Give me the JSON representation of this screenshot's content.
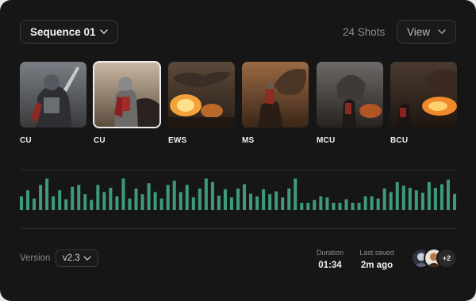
{
  "header": {
    "sequence_label": "Sequence 01",
    "shots_count": "24 Shots",
    "view_label": "View"
  },
  "shots": [
    {
      "label": "CU",
      "selected": false
    },
    {
      "label": "CU",
      "selected": true
    },
    {
      "label": "EWS",
      "selected": false
    },
    {
      "label": "MS",
      "selected": false
    },
    {
      "label": "MCU",
      "selected": false
    },
    {
      "label": "BCU",
      "selected": false
    }
  ],
  "waveform": {
    "color": "#3f9a7d",
    "levels": [
      0.38,
      0.55,
      0.32,
      0.7,
      0.88,
      0.38,
      0.55,
      0.3,
      0.65,
      0.7,
      0.44,
      0.28,
      0.7,
      0.5,
      0.62,
      0.38,
      0.88,
      0.32,
      0.6,
      0.44,
      0.75,
      0.5,
      0.32,
      0.7,
      0.82,
      0.5,
      0.7,
      0.35,
      0.6,
      0.88,
      0.78,
      0.4,
      0.58,
      0.35,
      0.6,
      0.72,
      0.45,
      0.38,
      0.58,
      0.44,
      0.52,
      0.35,
      0.6,
      0.88,
      0.2,
      0.2,
      0.28,
      0.38,
      0.35,
      0.2,
      0.2,
      0.3,
      0.2,
      0.2,
      0.38,
      0.38,
      0.32,
      0.6,
      0.5,
      0.78,
      0.68,
      0.62,
      0.55,
      0.48,
      0.78,
      0.62,
      0.72,
      0.85,
      0.45
    ]
  },
  "footer": {
    "version_label": "Version",
    "version_value": "v2.3",
    "duration_label": "Duration",
    "duration_value": "01:34",
    "saved_label": "Last saved",
    "saved_value": "2m ago",
    "extra_collaborators": "+2"
  }
}
